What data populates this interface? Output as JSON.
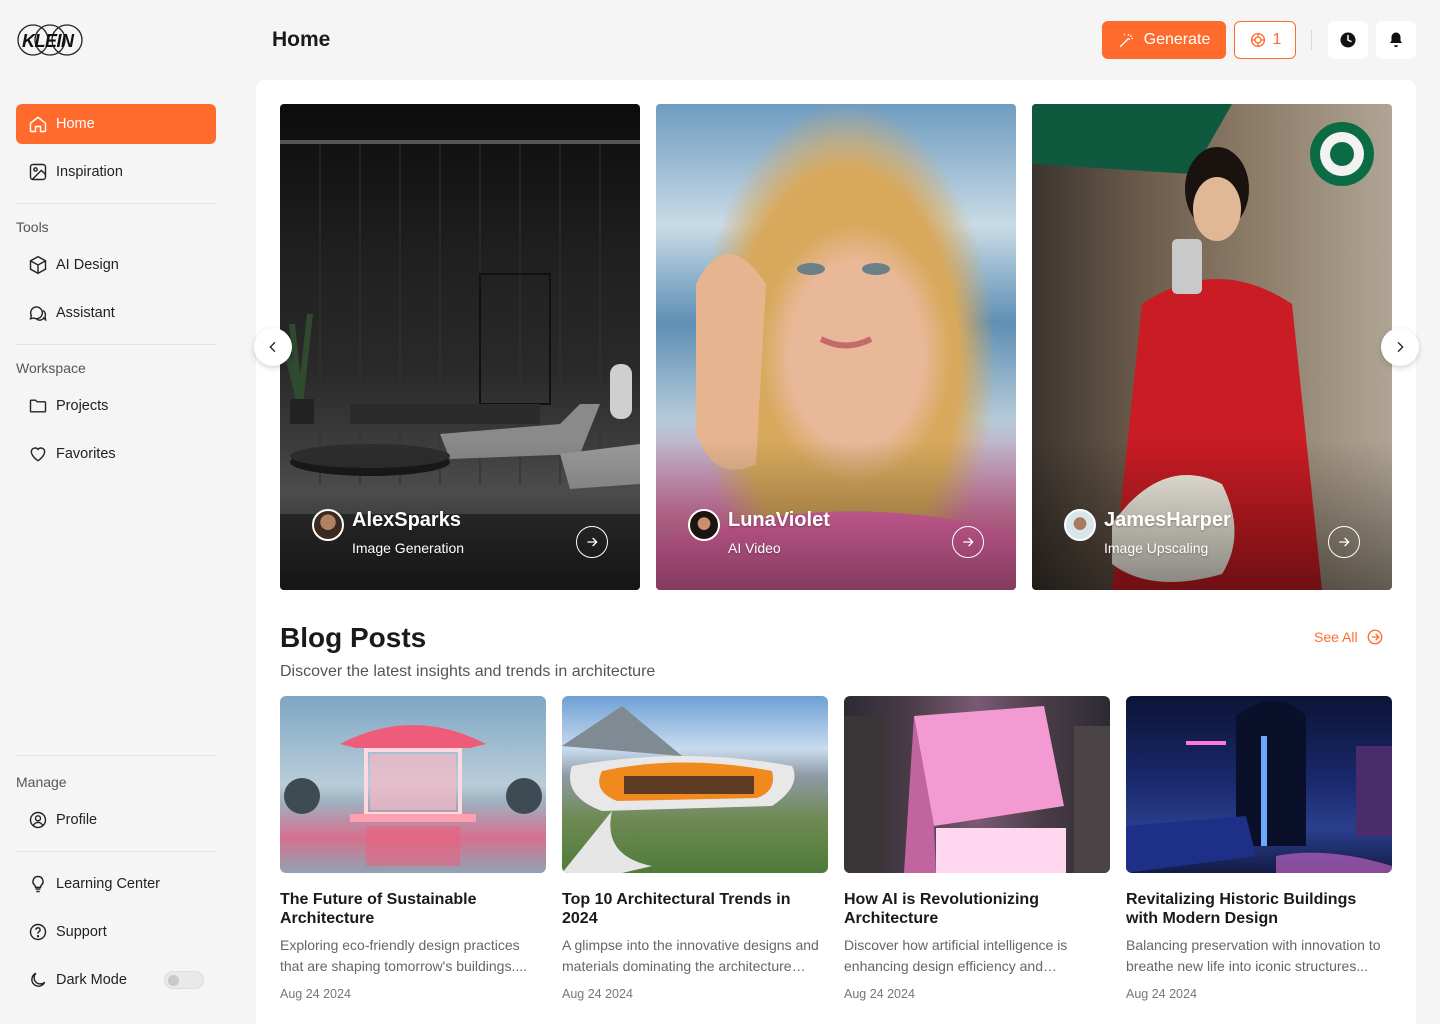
{
  "app": {
    "logo_text": "KLEIN"
  },
  "sidebar": {
    "primary": [
      {
        "label": "Home",
        "icon": "home-icon",
        "active": true
      },
      {
        "label": "Inspiration",
        "icon": "image-icon"
      }
    ],
    "tools_label": "Tools",
    "tools": [
      {
        "label": "AI Design",
        "icon": "cube-icon"
      },
      {
        "label": "Assistant",
        "icon": "chat-icon"
      }
    ],
    "workspace_label": "Workspace",
    "workspace": [
      {
        "label": "Projects",
        "icon": "folder-icon"
      },
      {
        "label": "Favorites",
        "icon": "heart-icon"
      }
    ],
    "manage_label": "Manage",
    "manage": [
      {
        "label": "Profile",
        "icon": "user-icon"
      }
    ],
    "footer": [
      {
        "label": "Learning Center",
        "icon": "lightbulb-icon"
      },
      {
        "label": "Support",
        "icon": "help-icon"
      },
      {
        "label": "Dark Mode",
        "icon": "moon-icon"
      }
    ],
    "dark_mode_on": false
  },
  "header": {
    "title": "Home",
    "generate_label": "Generate",
    "credits": "1"
  },
  "carousel": [
    {
      "name": "AlexSparks",
      "type": "Image Generation",
      "icon": "arrow-right-icon"
    },
    {
      "name": "LunaViolet",
      "type": "AI Video",
      "icon": "arrow-right-icon"
    },
    {
      "name": "JamesHarper",
      "type": "Image Upscaling",
      "icon": "arrow-right-icon"
    }
  ],
  "blog": {
    "title": "Blog Posts",
    "subtitle": "Discover the latest insights and trends in architecture",
    "see_all": "See All",
    "posts": [
      {
        "title": "The Future of Sustainable Architecture",
        "desc": "Exploring eco-friendly design practices that are shaping tomorrow's buildings....",
        "date": "Aug 24 2024"
      },
      {
        "title": "Top 10 Architectural Trends in 2024",
        "desc": "A glimpse into the innovative designs and materials dominating the architecture industry...",
        "date": "Aug 24 2024"
      },
      {
        "title": "How AI is Revolutionizing Architecture",
        "desc": "Discover how artificial intelligence is enhancing design efficiency and creativity...",
        "date": "Aug 24 2024"
      },
      {
        "title": "Revitalizing Historic Buildings with Modern Design",
        "desc": "Balancing preservation with innovation to breathe new life into iconic structures...",
        "date": "Aug 24 2024"
      }
    ]
  },
  "colors": {
    "accent": "#ff6b2c",
    "background": "#f5f5f5",
    "card": "#ffffff"
  }
}
